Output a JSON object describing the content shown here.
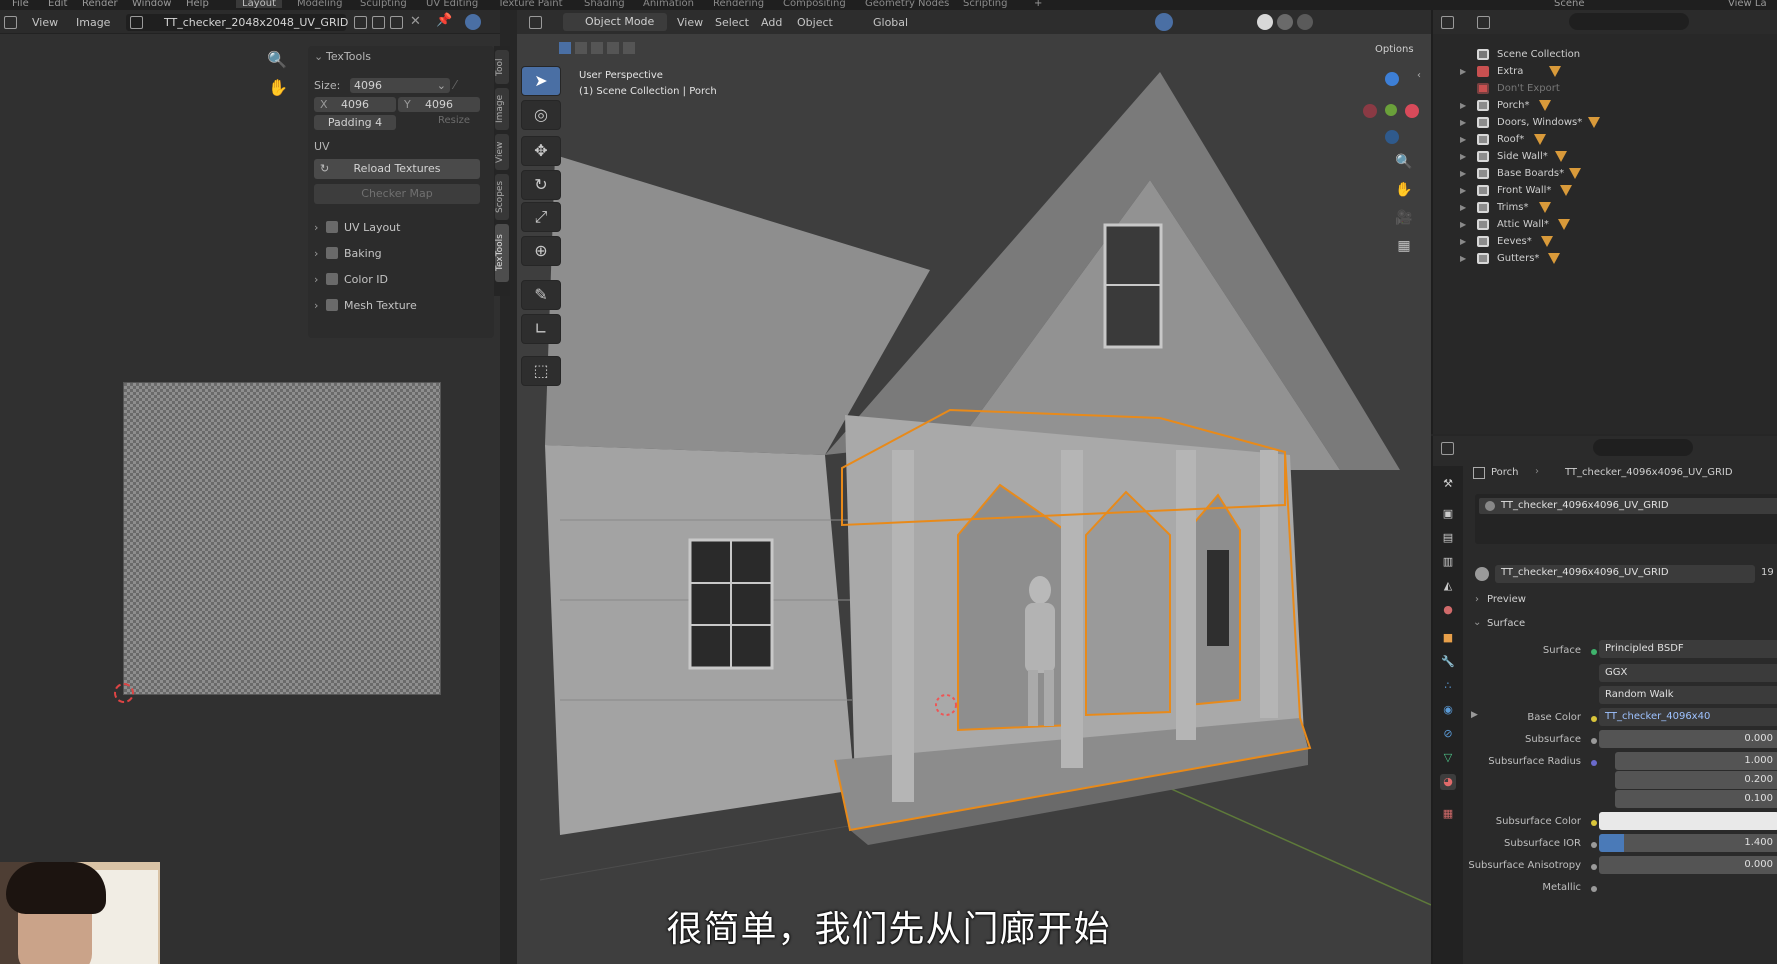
{
  "menubar": {
    "items": [
      "File",
      "Edit",
      "Render",
      "Window",
      "Help"
    ],
    "workspaces": [
      "Layout",
      "Modeling",
      "Sculpting",
      "UV Editing",
      "Texture Paint",
      "Shading",
      "Animation",
      "Rendering",
      "Compositing",
      "Geometry Nodes",
      "Scripting"
    ],
    "active_workspace": "Layout",
    "add_tab": "+",
    "scene_name": "Scene",
    "view_layer": "View La"
  },
  "uv_editor": {
    "menu": [
      "View",
      "Image"
    ],
    "image_name": "TT_checker_2048x2048_UV_GRID",
    "side_tabs": [
      "Tool",
      "Image",
      "View",
      "Scopes",
      "TexTools"
    ],
    "textools": {
      "title": "TexTools",
      "size_label": "Size:",
      "size_value": "4096",
      "x_label": "X",
      "x_value": "4096",
      "y_label": "Y",
      "y_value": "4096",
      "padding_label": "Padding",
      "padding_value": "4",
      "resize_label": "Resize",
      "uv_label": "UV",
      "reload_label": "Reload Textures",
      "checker_label": "Checker Map",
      "sections": [
        "UV Layout",
        "Baking",
        "Color ID",
        "Mesh Texture"
      ]
    }
  },
  "viewport": {
    "mode": "Object Mode",
    "menu": [
      "View",
      "Select",
      "Add",
      "Object"
    ],
    "transform_orientation": "Global",
    "options_label": "Options",
    "perspective_label": "User Perspective",
    "collection_label": "(1) Scene Collection | Porch",
    "subtitle": "很简单，我们先从门廊开始"
  },
  "outliner": {
    "root": "Scene Collection",
    "items": [
      {
        "label": "Extra",
        "dim": false
      },
      {
        "label": "Don't Export",
        "dim": true
      },
      {
        "label": "Porch*",
        "dim": false
      },
      {
        "label": "Doors, Windows*",
        "dim": false
      },
      {
        "label": "Roof*",
        "dim": false
      },
      {
        "label": "Side Wall*",
        "dim": false
      },
      {
        "label": "Base Boards*",
        "dim": false
      },
      {
        "label": "Front Wall*",
        "dim": false
      },
      {
        "label": "Trims*",
        "dim": false
      },
      {
        "label": "Attic Wall*",
        "dim": false
      },
      {
        "label": "Eeves*",
        "dim": false
      },
      {
        "label": "Gutters*",
        "dim": false
      }
    ]
  },
  "properties": {
    "breadcrumb_object": "Porch",
    "breadcrumb_material": "TT_checker_4096x4096_UV_GRID",
    "material_slot": "TT_checker_4096x4096_UV_GRID",
    "material_name": "TT_checker_4096x4096_UV_GRID",
    "user_count": "19",
    "preview_label": "Preview",
    "surface_label": "Surface",
    "rows": [
      {
        "label": "Surface",
        "value": "Principled BSDF",
        "dot": "#3fb36c"
      },
      {
        "label": "",
        "value": "GGX",
        "dot": ""
      },
      {
        "label": "",
        "value": "Random Walk",
        "dot": ""
      },
      {
        "label": "Base Color",
        "value": "TT_checker_4096x40",
        "dot": "#d9c53a"
      },
      {
        "label": "Subsurface",
        "value": "0.000",
        "dot": "#9a9a9a"
      },
      {
        "label": "Subsurface Radius",
        "value": "1.000",
        "dot": "#6a6acc"
      },
      {
        "label": "",
        "value": "0.200",
        "dot": ""
      },
      {
        "label": "",
        "value": "0.100",
        "dot": ""
      },
      {
        "label": "Subsurface Color",
        "value": "",
        "dot": "#d9c53a"
      },
      {
        "label": "Subsurface IOR",
        "value": "1.400",
        "dot": "#9a9a9a"
      },
      {
        "label": "Subsurface Anisotropy",
        "value": "0.000",
        "dot": "#9a9a9a"
      },
      {
        "label": "Metallic",
        "value": "",
        "dot": "#9a9a9a"
      }
    ]
  },
  "colors": {
    "accent": "#4a6fa4",
    "selection_outline": "#e88a1a",
    "collection_icon": "#d99a3a"
  }
}
